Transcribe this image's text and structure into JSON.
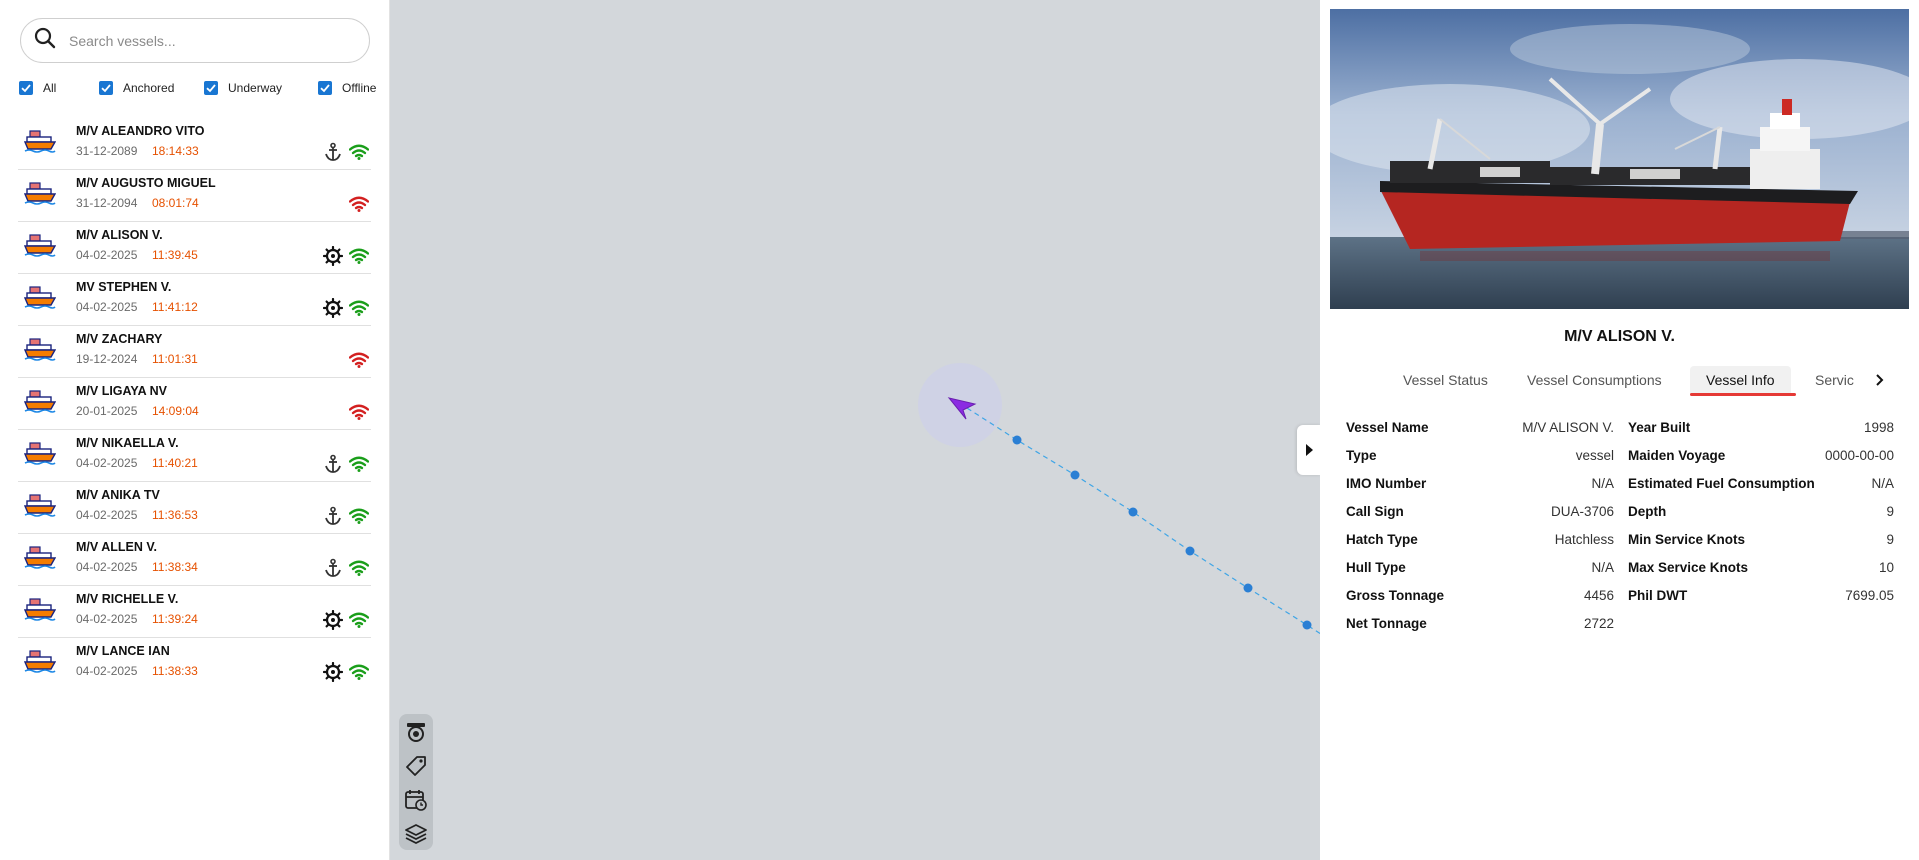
{
  "search": {
    "placeholder": "Search vessels..."
  },
  "filters": [
    {
      "label": "All",
      "checked": true
    },
    {
      "label": "Anchored",
      "checked": true
    },
    {
      "label": "Underway",
      "checked": true
    },
    {
      "label": "Offline",
      "checked": true
    }
  ],
  "vessels": [
    {
      "name": "M/V ALEANDRO VITO",
      "date": "31-12-2089",
      "time": "18:14:33",
      "status": "anchored",
      "signal": "online"
    },
    {
      "name": "M/V AUGUSTO MIGUEL",
      "date": "31-12-2094",
      "time": "08:01:74",
      "status": "offline",
      "signal": "offline"
    },
    {
      "name": "M/V ALISON V.",
      "date": "04-02-2025",
      "time": "11:39:45",
      "status": "underway",
      "signal": "online"
    },
    {
      "name": "MV STEPHEN V.",
      "date": "04-02-2025",
      "time": "11:41:12",
      "status": "underway",
      "signal": "online"
    },
    {
      "name": "M/V ZACHARY",
      "date": "19-12-2024",
      "time": "11:01:31",
      "status": "offline",
      "signal": "offline"
    },
    {
      "name": "M/V LIGAYA NV",
      "date": "20-01-2025",
      "time": "14:09:04",
      "status": "offline",
      "signal": "offline"
    },
    {
      "name": "M/V NIKAELLA V.",
      "date": "04-02-2025",
      "time": "11:40:21",
      "status": "anchored",
      "signal": "online"
    },
    {
      "name": "M/V ANIKA TV",
      "date": "04-02-2025",
      "time": "11:36:53",
      "status": "anchored",
      "signal": "online"
    },
    {
      "name": "M/V ALLEN V.",
      "date": "04-02-2025",
      "time": "11:38:34",
      "status": "anchored",
      "signal": "online"
    },
    {
      "name": "M/V RICHELLE V.",
      "date": "04-02-2025",
      "time": "11:39:24",
      "status": "underway",
      "signal": "online"
    },
    {
      "name": "M/V LANCE IAN",
      "date": "04-02-2025",
      "time": "11:38:33",
      "status": "underway",
      "signal": "online"
    }
  ],
  "colors": {
    "accent": "#1976d2",
    "time": "#e65100",
    "signal_online": "#1a9e1a",
    "signal_offline": "#d32020",
    "vessel_marker": "#8b2be2",
    "track": "#2a7fd4",
    "tab_underline": "#e53935"
  },
  "map": {
    "tools": [
      "camera-icon",
      "tag-icon",
      "calendar-clock-icon",
      "layers-icon"
    ]
  },
  "panel": {
    "title": "M/V ALISON V.",
    "tabs": [
      {
        "label": "Vessel Status",
        "active": false
      },
      {
        "label": "Vessel Consumptions",
        "active": false
      },
      {
        "label": "Vessel Info",
        "active": true
      },
      {
        "label": "Servic",
        "active": false
      }
    ],
    "info_left": [
      {
        "label": "Vessel Name",
        "value": "M/V ALISON V."
      },
      {
        "label": "Type",
        "value": "vessel"
      },
      {
        "label": "IMO Number",
        "value": "N/A"
      },
      {
        "label": "Call Sign",
        "value": "DUA-3706"
      },
      {
        "label": "Hatch Type",
        "value": "Hatchless"
      },
      {
        "label": "Hull Type",
        "value": "N/A"
      },
      {
        "label": "Gross Tonnage",
        "value": "4456"
      },
      {
        "label": "Net Tonnage",
        "value": "2722"
      }
    ],
    "info_right": [
      {
        "label": "Year Built",
        "value": "1998"
      },
      {
        "label": "Maiden Voyage",
        "value": "0000-00-00"
      },
      {
        "label": "Estimated Fuel Consumption",
        "value": "N/A"
      },
      {
        "label": "Depth",
        "value": "9"
      },
      {
        "label": "Min Service Knots",
        "value": "9"
      },
      {
        "label": "Max Service Knots",
        "value": "10"
      },
      {
        "label": "Phil DWT",
        "value": "7699.05"
      }
    ]
  }
}
